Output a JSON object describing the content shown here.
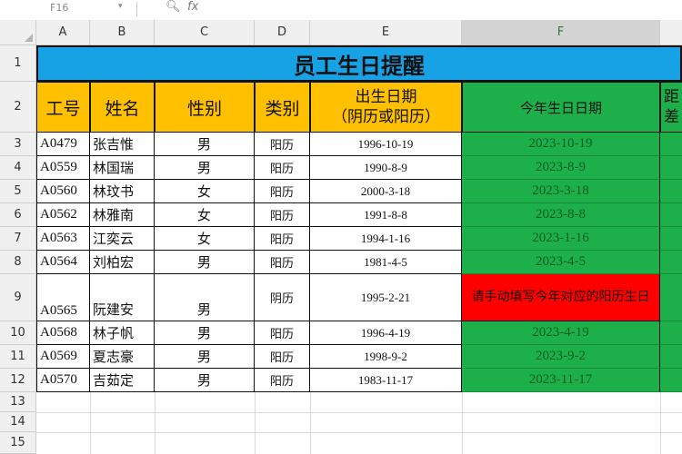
{
  "formula_bar": {
    "cell_ref": "F16",
    "fx": "fx"
  },
  "column_headers": [
    "A",
    "B",
    "C",
    "D",
    "E",
    "F"
  ],
  "row_headers": [
    "1",
    "2",
    "3",
    "4",
    "5",
    "6",
    "7",
    "8",
    "9",
    "10",
    "11",
    "12",
    "13",
    "14",
    "15"
  ],
  "sheet": {
    "title": "员工生日提醒",
    "headers": {
      "id": "工号",
      "name": "姓名",
      "gender": "性别",
      "type": "类别",
      "birth_line1": "出生日期",
      "birth_line2": "（阴历或阳历）",
      "this_year": "今年生日日期",
      "cut1": "距",
      "cut2": "差"
    },
    "rows": [
      {
        "id": "A0479",
        "name": "张吉惟",
        "gender": "男",
        "type": "阳历",
        "birth": "1996-10-19",
        "this_year": "2023-10-19"
      },
      {
        "id": "A0559",
        "name": "林国瑞",
        "gender": "男",
        "type": "阳历",
        "birth": "1990-8-9",
        "this_year": "2023-8-9"
      },
      {
        "id": "A0560",
        "name": "林玟书",
        "gender": "女",
        "type": "阳历",
        "birth": "2000-3-18",
        "this_year": "2023-3-18"
      },
      {
        "id": "A0562",
        "name": "林雅南",
        "gender": "女",
        "type": "阳历",
        "birth": "1991-8-8",
        "this_year": "2023-8-8"
      },
      {
        "id": "A0563",
        "name": "江奕云",
        "gender": "女",
        "type": "阳历",
        "birth": "1994-1-16",
        "this_year": "2023-1-16"
      },
      {
        "id": "A0564",
        "name": "刘柏宏",
        "gender": "男",
        "type": "阳历",
        "birth": "1981-4-5",
        "this_year": "2023-4-5"
      },
      {
        "id": "A0565",
        "name": "阮建安",
        "gender": "男",
        "type": "阴历",
        "birth": "1995-2-21",
        "this_year": "请手动填写今年对应的阳历生日"
      },
      {
        "id": "A0568",
        "name": "林子帆",
        "gender": "男",
        "type": "阳历",
        "birth": "1996-4-19",
        "this_year": "2023-4-19"
      },
      {
        "id": "A0569",
        "name": "夏志豪",
        "gender": "男",
        "type": "阳历",
        "birth": "1998-9-2",
        "this_year": "2023-9-2"
      },
      {
        "id": "A0570",
        "name": "吉茹定",
        "gender": "男",
        "type": "阳历",
        "birth": "1983-11-17",
        "this_year": "2023-11-17"
      }
    ]
  },
  "colors": {
    "title_fill": "#17a2e6",
    "header_fill": "#ffc000",
    "green_fill": "#1db04a",
    "warning_fill": "#ff0000"
  }
}
